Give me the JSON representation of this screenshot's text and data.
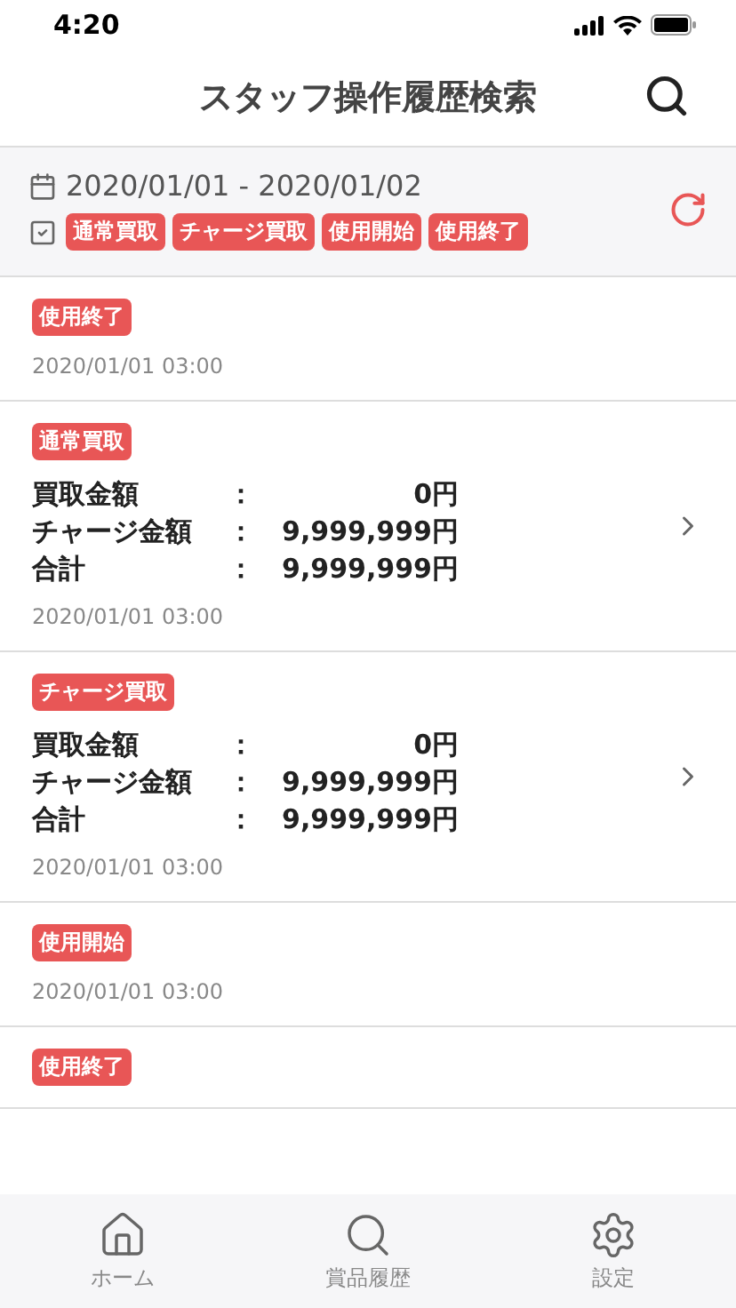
{
  "status_bar": {
    "time": "4:20"
  },
  "header": {
    "title": "スタッフ操作履歴検索"
  },
  "filter": {
    "date_range": "2020/01/01 - 2020/01/02",
    "tags": [
      "通常買取",
      "チャージ買取",
      "使用開始",
      "使用終了"
    ]
  },
  "history": [
    {
      "tag": "使用終了",
      "date": "2020/01/01 03:00"
    },
    {
      "tag": "通常買取",
      "details": [
        {
          "label": "買取金額",
          "sep": "：",
          "value": "0円"
        },
        {
          "label": "チャージ金額",
          "sep": "：",
          "value": "9,999,999円"
        },
        {
          "label": "合計",
          "sep": "：",
          "value": "9,999,999円"
        }
      ],
      "date": "2020/01/01 03:00"
    },
    {
      "tag": "チャージ買取",
      "details": [
        {
          "label": "買取金額",
          "sep": "：",
          "value": "0円"
        },
        {
          "label": "チャージ金額",
          "sep": "：",
          "value": "9,999,999円"
        },
        {
          "label": "合計",
          "sep": "：",
          "value": "9,999,999円"
        }
      ],
      "date": "2020/01/01 03:00"
    },
    {
      "tag": "使用開始",
      "date": "2020/01/01 03:00"
    },
    {
      "tag": "使用終了"
    }
  ],
  "tab_bar": [
    {
      "kind": "home",
      "label": "ホーム"
    },
    {
      "kind": "search",
      "label": "賞品履歴"
    },
    {
      "kind": "settings",
      "label": "設定"
    }
  ]
}
